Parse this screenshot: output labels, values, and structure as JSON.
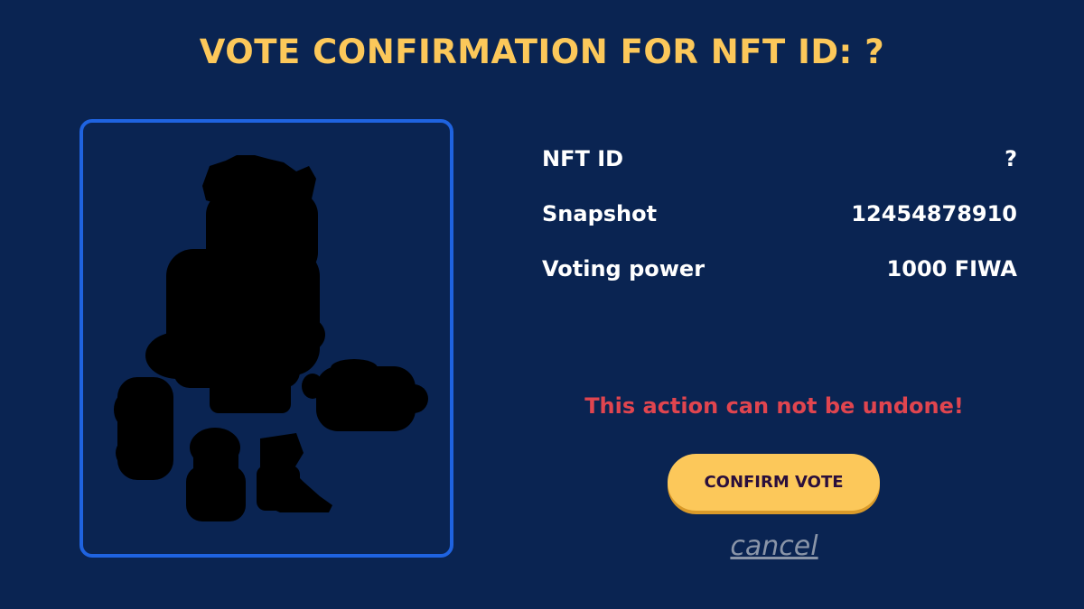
{
  "dialog": {
    "title": "VOTE CONFIRMATION FOR NFT ID: ?",
    "rows": [
      {
        "label": "NFT ID",
        "value": "?"
      },
      {
        "label": "Snapshot",
        "value": "12454878910"
      },
      {
        "label": "Voting power",
        "value": "1000 FIWA"
      }
    ],
    "warning": "This action can not be undone!",
    "confirm_label": "CONFIRM VOTE",
    "cancel_label": "cancel"
  },
  "colors": {
    "background": "#0a2452",
    "title": "#fcc85a",
    "frame_border": "#1f63e0",
    "warning": "#e0454f",
    "button": "#fcc85a",
    "button_text": "#2a0f3c",
    "cancel": "#8a95a8"
  },
  "nft_image": {
    "icon": "character-silhouette-icon",
    "state": "hidden"
  }
}
